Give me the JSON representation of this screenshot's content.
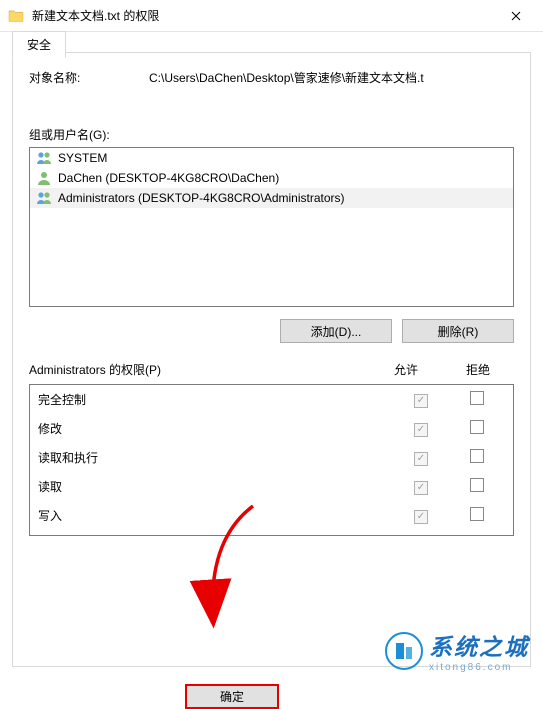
{
  "titlebar": {
    "title": "新建文本文档.txt 的权限"
  },
  "tab": {
    "label": "安全"
  },
  "object": {
    "label": "对象名称:",
    "path": "C:\\Users\\DaChen\\Desktop\\管家速修\\新建文本文档.t"
  },
  "groups": {
    "label": "组或用户名(G):",
    "items": [
      {
        "icon": "group",
        "name": "SYSTEM",
        "selected": false
      },
      {
        "icon": "user",
        "name": "DaChen (DESKTOP-4KG8CRO\\DaChen)",
        "selected": false
      },
      {
        "icon": "group",
        "name": "Administrators (DESKTOP-4KG8CRO\\Administrators)",
        "selected": true
      }
    ]
  },
  "buttons": {
    "add": "添加(D)...",
    "remove": "删除(R)"
  },
  "permissions": {
    "header_label": "Administrators 的权限(P)",
    "col_allow": "允许",
    "col_deny": "拒绝",
    "rows": [
      {
        "label": "完全控制",
        "allow": true,
        "deny": false
      },
      {
        "label": "修改",
        "allow": true,
        "deny": false
      },
      {
        "label": "读取和执行",
        "allow": true,
        "deny": false
      },
      {
        "label": "读取",
        "allow": true,
        "deny": false
      },
      {
        "label": "写入",
        "allow": true,
        "deny": false
      }
    ]
  },
  "footer": {
    "ok": "确定"
  },
  "watermark": {
    "text": "系统之城",
    "sub": "xitong86.com"
  }
}
